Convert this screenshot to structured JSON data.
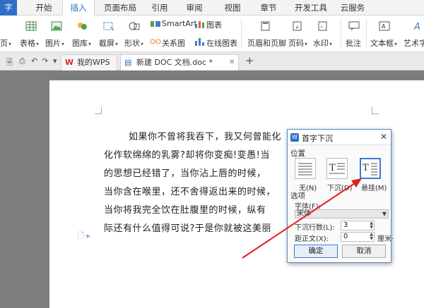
{
  "app_button": "字",
  "menu_tabs": [
    "开始",
    "插入",
    "页面布局",
    "引用",
    "审阅",
    "视图",
    "章节",
    "开发工具",
    "云服务"
  ],
  "active_menu_tab": "插入",
  "ribbon": {
    "cut_label": "页",
    "table": "表格",
    "picture": "图片",
    "gallery": "图库",
    "screenshot": "截屏",
    "shape": "形状",
    "smartart": "SmartArt",
    "chart": "图表",
    "relation": "关系图",
    "online_chart": "在线图表",
    "header_footer": "页眉和页脚",
    "page_number": "页码",
    "watermark": "水印",
    "comment": "批注",
    "textbox": "文本框",
    "wordart": "艺术字"
  },
  "tabs": {
    "wps_tab": "我的WPS",
    "doc_tab": "新建 DOC 文档.doc *",
    "add": "+"
  },
  "document": {
    "lines": [
      "如果你不曾将我吞下，我又何曾能化",
      "化作软绵绵的乳雾?却将你变痴!变愚!当",
      "的思想已经错了，当你沾上唇的时候，",
      "当你含在喉里，还不舍得返出来的时候，",
      "当你将我完全饮在肚腹里的时候，纵有",
      "际还有什么值得可说?于是你就被这美丽"
    ]
  },
  "dialog": {
    "logo": "W",
    "title": "首字下沉",
    "close": "✕",
    "position_label": "位置",
    "options": [
      "无(N)",
      "下沉(D)",
      "悬挂(M)"
    ],
    "selected_option": "悬挂(M)",
    "options_label": "选项",
    "font_label": "字体(F):",
    "font_value": "宋体",
    "lines_label": "下沉行数(L):",
    "lines_value": "3",
    "distance_label": "距正文(X):",
    "distance_value": "0",
    "distance_unit": "厘米·",
    "ok": "确定",
    "cancel": "取消"
  },
  "colors": {
    "accent": "#2d6fc4",
    "annotation_arrow": "#e02020"
  }
}
